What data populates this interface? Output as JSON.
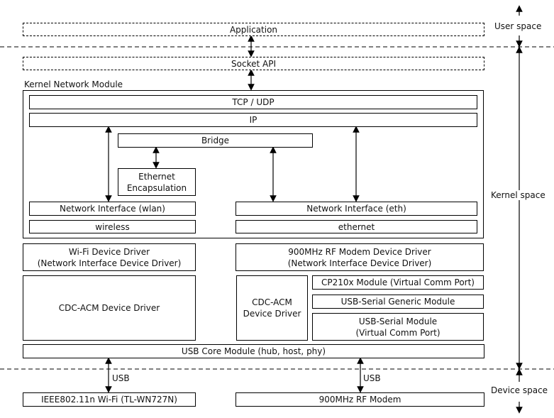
{
  "layers": {
    "user": "User space",
    "kernel": "Kernel space",
    "device": "Device space"
  },
  "application": "Application",
  "socket_api": "Socket API",
  "kernel_module_label": "Kernel Network Module",
  "tcp_udp": "TCP / UDP",
  "ip": "IP",
  "bridge": "Bridge",
  "ethernet_encapsulation": "Ethernet\nEncapsulation",
  "ni_wlan": "Network Interface (wlan)",
  "ni_eth": "Network Interface (eth)",
  "wireless": "wireless",
  "ethernet": "ethernet",
  "wifi_driver": "Wi-Fi Device Driver\n(Network Interface Device Driver)",
  "rf_driver": "900MHz RF Modem Device Driver\n(Network Interface Device Driver)",
  "cdc_acm_left": "CDC-ACM Device Driver",
  "cdc_acm_right": "CDC-ACM\nDevice Driver",
  "cp210x": "CP210x Module (Virtual Comm Port)",
  "usb_serial_generic": "USB-Serial Generic Module",
  "usb_serial_module": "USB-Serial Module\n(Virtual Comm Port)",
  "usb_core": "USB Core Module (hub, host, phy)",
  "usb_label_left": "USB",
  "usb_label_right": "USB",
  "wifi_device": "IEEE802.11n Wi-Fi (TL-WN727N)",
  "rf_modem": "900MHz RF Modem"
}
